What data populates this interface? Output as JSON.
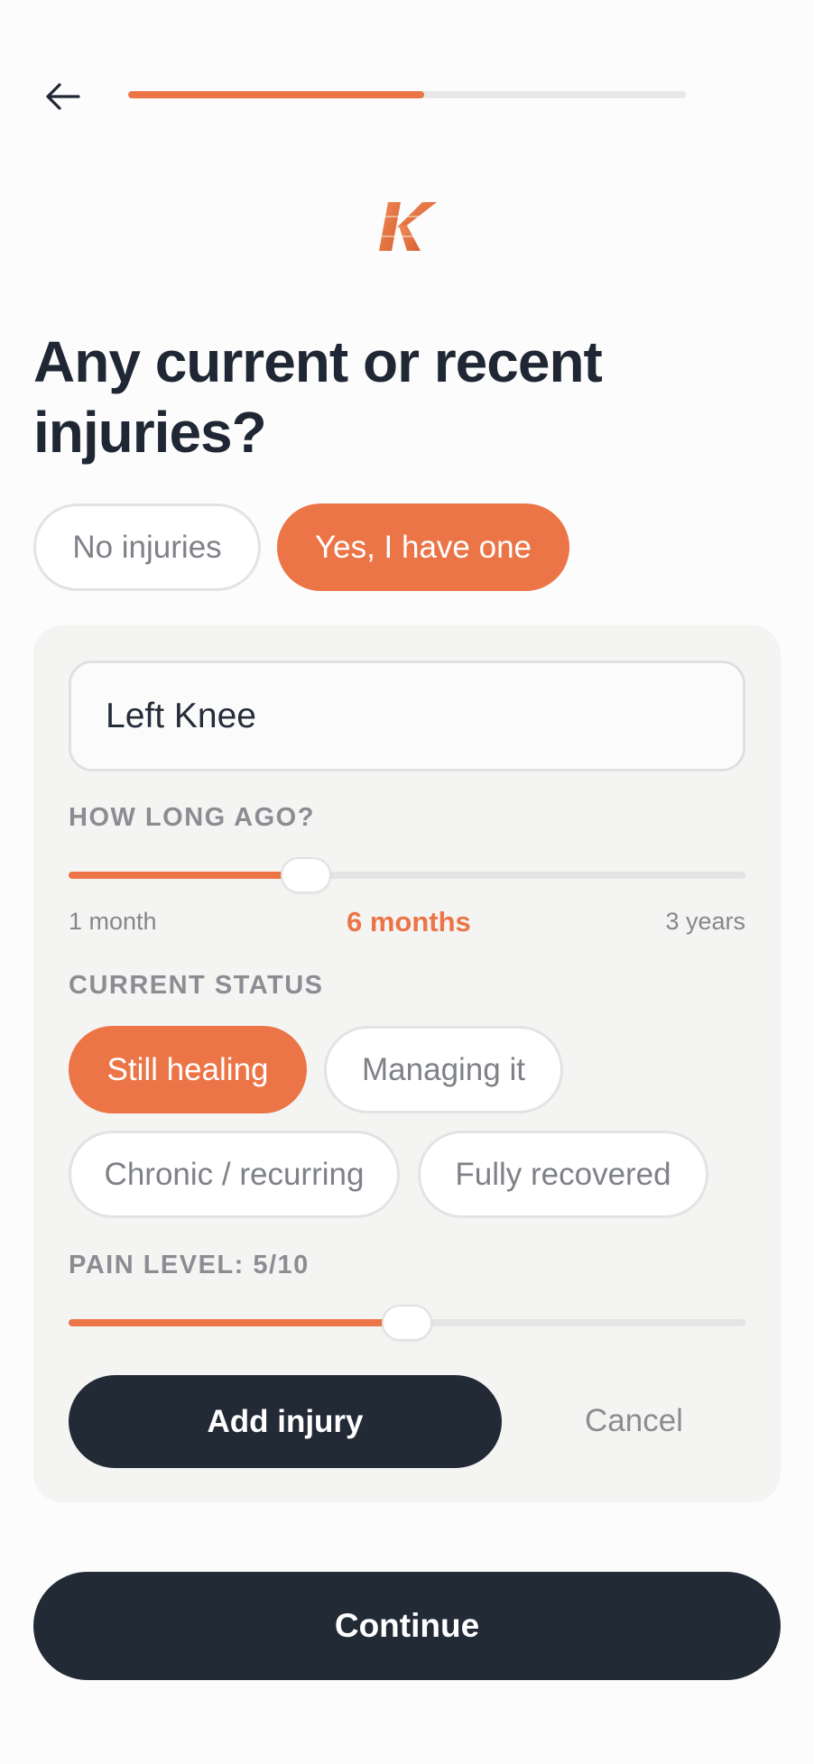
{
  "header": {
    "back_icon": "arrow-left-icon",
    "progress_fraction": 0.53
  },
  "logo": {
    "letter": "K",
    "color": "#ec7547"
  },
  "question": {
    "title": "Any current or recent injuries?"
  },
  "injury_choice": {
    "no_label": "No injuries",
    "yes_label": "Yes, I have one",
    "selected": "yes"
  },
  "injury_form": {
    "location_value": "Left Knee",
    "how_long": {
      "label": "HOW LONG AGO?",
      "min_label": "1 month",
      "value_label": "6 months",
      "max_label": "3 years",
      "fraction": 0.35
    },
    "status": {
      "label": "CURRENT STATUS",
      "options": [
        "Still healing",
        "Managing it",
        "Chronic / recurring",
        "Fully recovered"
      ],
      "selected": "Still healing"
    },
    "pain": {
      "label": "PAIN LEVEL: 5/10",
      "value": 5,
      "max": 10
    },
    "add_label": "Add injury",
    "cancel_label": "Cancel"
  },
  "footer": {
    "continue_label": "Continue"
  },
  "colors": {
    "accent": "#ec7547",
    "dark": "#222a36",
    "card": "#f4f4f3"
  }
}
